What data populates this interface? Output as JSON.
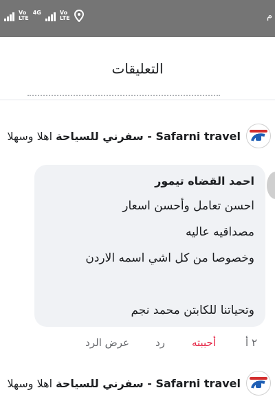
{
  "status_bar": {
    "network_labels": [
      "Vo",
      "LTE",
      "4G",
      "Vo",
      "LTE"
    ],
    "right_text": "م"
  },
  "header": {
    "title": "التعليقات"
  },
  "replies": [
    {
      "page_name": "Safarni travel - سفرني للسياحة",
      "text": "اهلا وسهلا"
    },
    {
      "page_name": "Safarni travel - سفرني للسياحة",
      "text": "اهلا وسهلا"
    }
  ],
  "comment": {
    "author": "احمد القضاه تيمور",
    "lines": [
      "احسن تعامل وأحسن اسعار",
      "مصداقيه عاليه",
      "وخصوصا من كل اشي اسمه الاردن",
      "",
      "وتحياتنا للكابتن محمد نجم"
    ],
    "time": "٢ أ",
    "like_label": "أحببته",
    "reply_label": "رد",
    "view_replies_label": "عرض الرد"
  },
  "colors": {
    "status_bar": "#757575",
    "like_active": "#e41e3f",
    "brand_blue": "#1f5fb5"
  },
  "icons": [
    "signal-icon",
    "location-icon",
    "page-logo-icon"
  ]
}
